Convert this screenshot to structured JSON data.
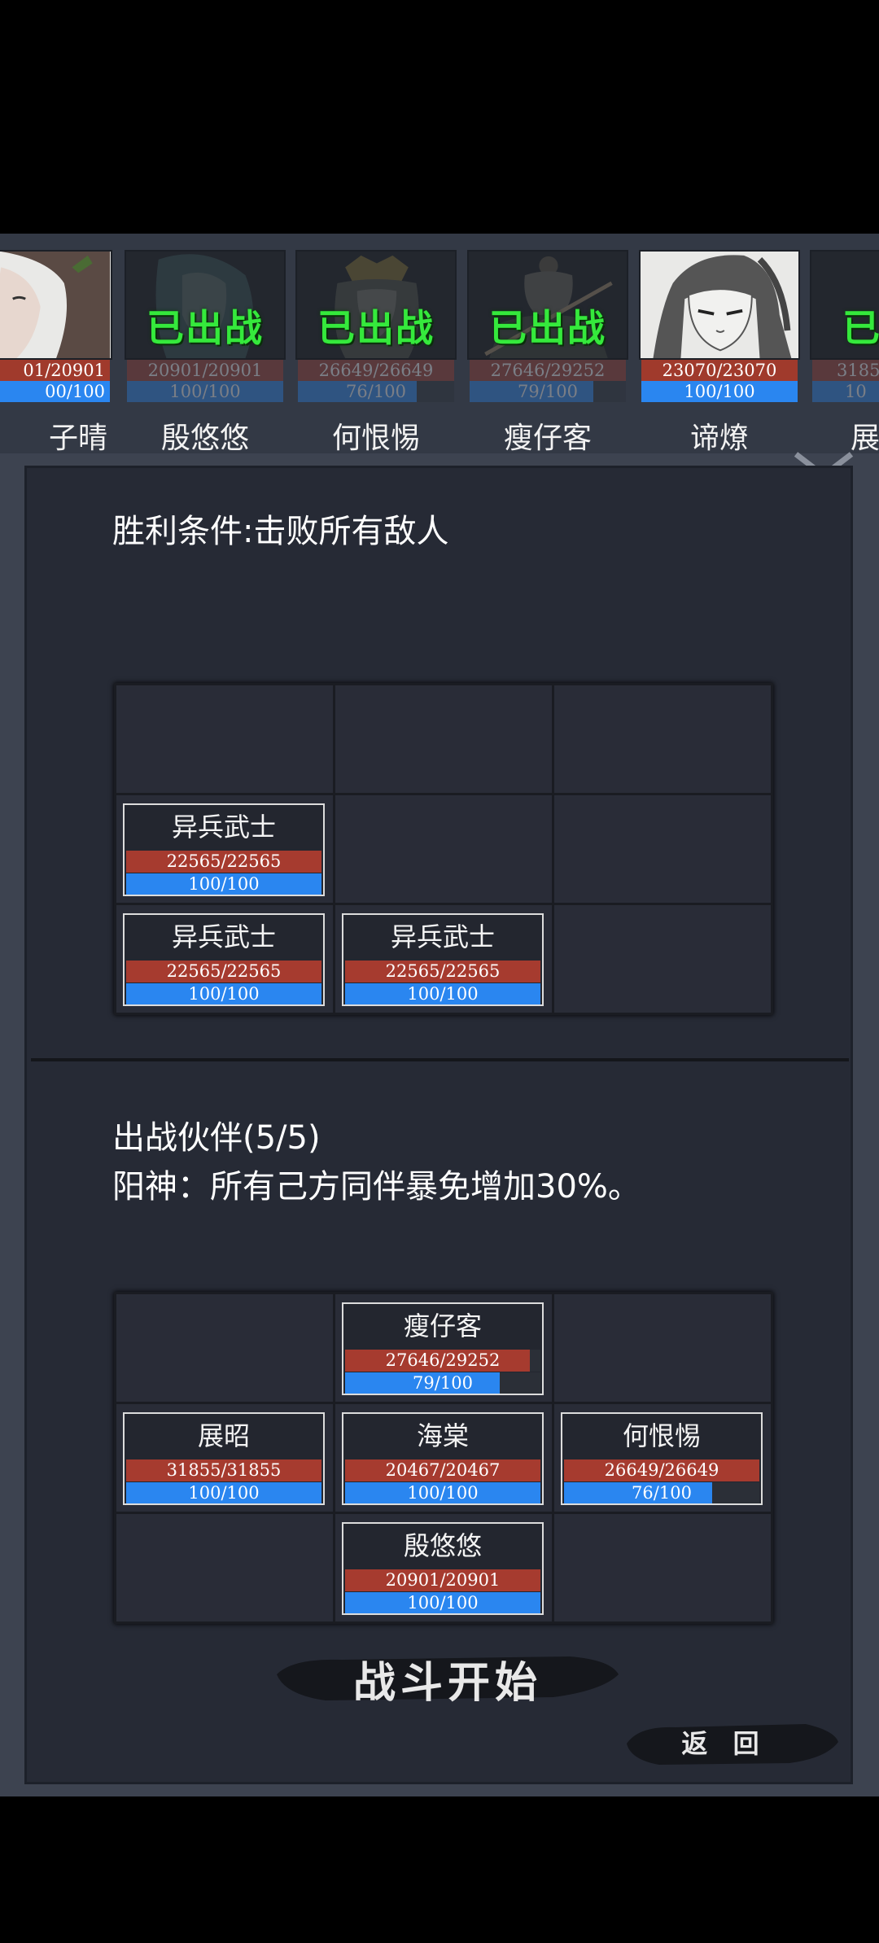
{
  "roster": [
    {
      "name": "子晴",
      "name_visible": "子晴",
      "hp": "01/20901",
      "mp": "00/100",
      "mp_fill": 1.0,
      "deployed": false,
      "portrait": "female-hero-portrait"
    },
    {
      "name": "殷悠悠",
      "hp": "20901/20901",
      "mp": "100/100",
      "mp_fill": 1.0,
      "deployed": true,
      "portrait": "female-hero-portrait"
    },
    {
      "name": "何恨惕",
      "hp": "26649/26649",
      "mp": "76/100",
      "mp_fill": 0.76,
      "deployed": true,
      "portrait": "crowned-hero-portrait"
    },
    {
      "name": "瘦仔客",
      "hp": "27646/29252",
      "mp": "79/100",
      "mp_fill": 0.79,
      "deployed": true,
      "portrait": "swordsman-portrait"
    },
    {
      "name": "谛燎",
      "hp": "23070/23070",
      "mp": "100/100",
      "mp_fill": 1.0,
      "deployed": false,
      "portrait": "male-hero-portrait"
    },
    {
      "name": "展",
      "hp": "3185",
      "mp": "10",
      "mp_fill": 1.0,
      "deployed": true,
      "portrait": "hero-portrait"
    }
  ],
  "deployed_label": "已出战",
  "deployed_label_partial": "已",
  "victory": {
    "label": "胜利条件:",
    "value": "击败所有敌人"
  },
  "enemy_grid": [
    {
      "row": 1,
      "col": 0,
      "name": "异兵武士",
      "hp": "22565/22565",
      "mp": "100/100",
      "mp_fill": 1.0
    },
    {
      "row": 2,
      "col": 0,
      "name": "异兵武士",
      "hp": "22565/22565",
      "mp": "100/100",
      "mp_fill": 1.0
    },
    {
      "row": 2,
      "col": 1,
      "name": "异兵武士",
      "hp": "22565/22565",
      "mp": "100/100",
      "mp_fill": 1.0
    }
  ],
  "party": {
    "title": "出战伙伴(5/5)",
    "buff": "阳神：所有己方同伴暴免增加30%。"
  },
  "party_grid": [
    {
      "row": 0,
      "col": 1,
      "name": "瘦仔客",
      "hp": "27646/29252",
      "mp": "79/100",
      "hp_fill": 0.945,
      "mp_fill": 0.79
    },
    {
      "row": 1,
      "col": 0,
      "name": "展昭",
      "hp": "31855/31855",
      "mp": "100/100",
      "hp_fill": 1.0,
      "mp_fill": 1.0
    },
    {
      "row": 1,
      "col": 1,
      "name": "海棠",
      "hp": "20467/20467",
      "mp": "100/100",
      "hp_fill": 1.0,
      "mp_fill": 1.0
    },
    {
      "row": 1,
      "col": 2,
      "name": "何恨惕",
      "hp": "26649/26649",
      "mp": "76/100",
      "hp_fill": 1.0,
      "mp_fill": 0.76
    },
    {
      "row": 2,
      "col": 1,
      "name": "殷悠悠",
      "hp": "20901/20901",
      "mp": "100/100",
      "hp_fill": 1.0,
      "mp_fill": 1.0
    }
  ],
  "start_button": "战斗开始",
  "back_button": "返 回",
  "colors": {
    "hp": "#a63b2f",
    "mp": "#2a86f0",
    "deployed": "#35e93c",
    "panel": "#262a35"
  }
}
